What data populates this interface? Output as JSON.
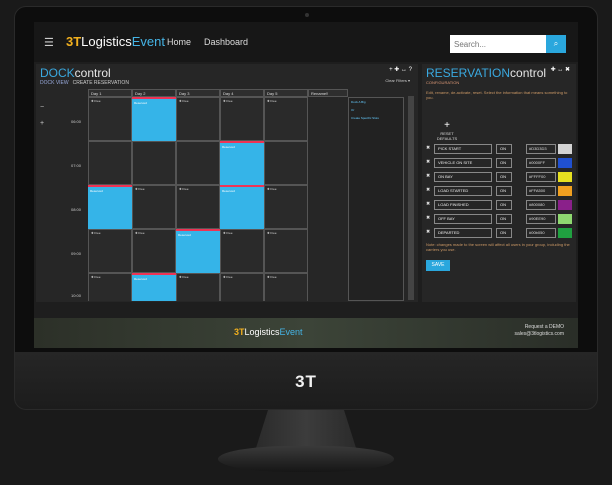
{
  "nav": {
    "brand_num": "3T",
    "brand_a": "Logistics",
    "brand_b": "Event",
    "home": "Home",
    "dashboard": "Dashboard",
    "search_placeholder": "Search..."
  },
  "dock": {
    "title_a": "DOCK",
    "title_b": "control",
    "sub_a": "DOCK VIEW",
    "sub_b": "CREATE RESERVATION",
    "icons": "+ ✚ ↔ ?",
    "clear_filters": "Clear Filters ▾",
    "columns": [
      "Day 1",
      "Day 2",
      "Day 3",
      "Day 4",
      "Day 5",
      "Rename!!"
    ],
    "times": [
      "06:00",
      "07:00",
      "08:00",
      "09:00",
      "10:00"
    ],
    "free_label": "✚ Free",
    "reservation_text": "Reserved",
    "rename_links": [
      "Dock A Big",
      "Or",
      "Create Specific Slots"
    ]
  },
  "config": {
    "title_a": "RESERVATION",
    "title_b": "control",
    "sub": "CONFIGURATION",
    "text": "Edit, rename, de-activate, reset. Select the information that means something to you.",
    "reset": "RESET DEFAULTS",
    "rows": [
      {
        "label": "PICK START",
        "on": "ON",
        "hex": "#D3D3D3",
        "color": "#d3d3d3"
      },
      {
        "label": "VEHICLE ON SITE",
        "on": "ON",
        "hex": "#0000FF",
        "color": "#2050d0"
      },
      {
        "label": "ON BAY",
        "on": "ON",
        "hex": "#FFFF00",
        "color": "#e6e020"
      },
      {
        "label": "LOAD STARTED",
        "on": "ON",
        "hex": "#FFA500",
        "color": "#f0a020"
      },
      {
        "label": "LOAD FINISHED",
        "on": "ON",
        "hex": "#800080",
        "color": "#8a208a"
      },
      {
        "label": "OFF BAY",
        "on": "ON",
        "hex": "#90EE90",
        "color": "#8ed870"
      },
      {
        "label": "DEPARTED",
        "on": "ON",
        "hex": "#00b050",
        "color": "#20a040"
      }
    ],
    "note": "Note: changes made to the screen will affect all users in your group, including the carriers you use.",
    "save": "SAVE"
  },
  "footer": {
    "brand_num": "3T",
    "brand_a": "Logistics",
    "brand_b": "Event",
    "request": "Request a DEMO",
    "email": "sales@3tlogistics.com"
  },
  "chin": {
    "logo": "3T"
  }
}
